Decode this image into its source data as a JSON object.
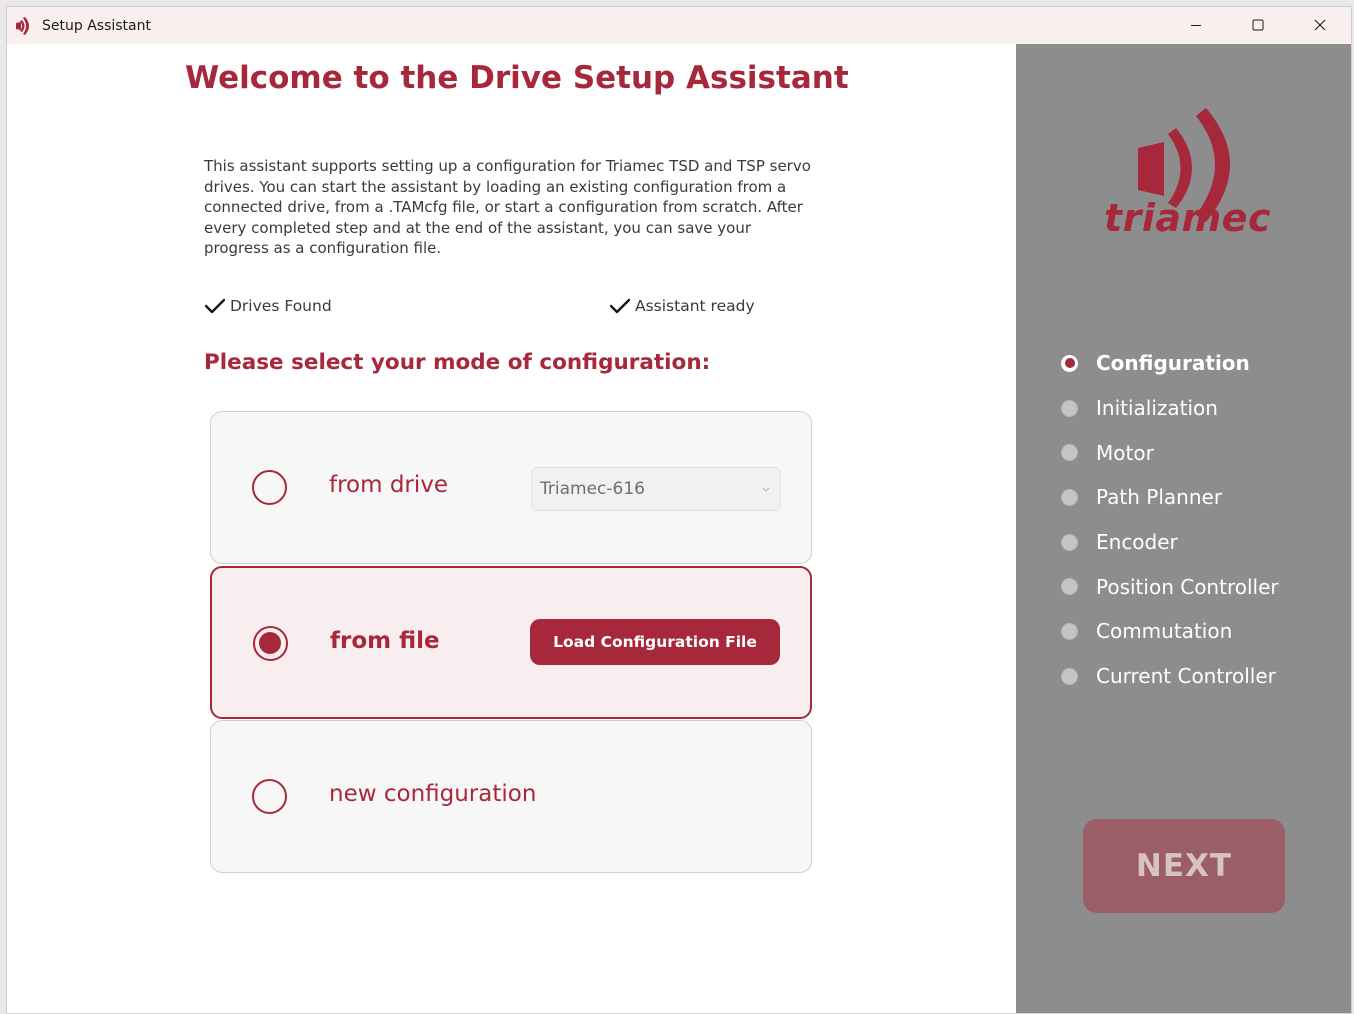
{
  "window": {
    "title": "Setup Assistant"
  },
  "main": {
    "heading": "Welcome to the Drive Setup Assistant",
    "intro": "This assistant supports setting up a configuration for Triamec TSD and TSP servo drives. You can start the assistant by loading an existing configuration from a connected drive, from a .TAMcfg file, or start a configuration from scratch. After every completed step and at the end of the assistant, you can save your progress as a configuration file.",
    "status": {
      "drives_found": "Drives Found",
      "assistant_ready": "Assistant ready"
    },
    "mode_prompt": "Please select your mode of configuration:",
    "options": [
      {
        "label": "from drive",
        "selected": false,
        "dropdown_value": "Triamec-616"
      },
      {
        "label": "from file",
        "selected": true,
        "button_label": "Load Configuration File"
      },
      {
        "label": "new configuration",
        "selected": false
      }
    ]
  },
  "sidebar": {
    "logo_text": "triamec",
    "steps": [
      {
        "label": "Configuration",
        "active": true
      },
      {
        "label": "Initialization",
        "active": false
      },
      {
        "label": "Motor",
        "active": false
      },
      {
        "label": "Path Planner",
        "active": false
      },
      {
        "label": "Encoder",
        "active": false
      },
      {
        "label": "Position Controller",
        "active": false
      },
      {
        "label": "Commutation",
        "active": false
      },
      {
        "label": "Current Controller",
        "active": false
      }
    ],
    "next_label": "NEXT"
  },
  "colors": {
    "brand": "#a7283a",
    "sidebar_bg": "#8d8d8d",
    "selected_option_bg": "#f9eeef",
    "next_disabled_bg": "#9c5e66"
  },
  "icons": {
    "app": "triamec-logo-icon",
    "minimize": "minimize-icon",
    "maximize": "maximize-icon",
    "close": "close-icon",
    "check": "checkmark-icon",
    "chevron": "chevron-down-icon"
  }
}
